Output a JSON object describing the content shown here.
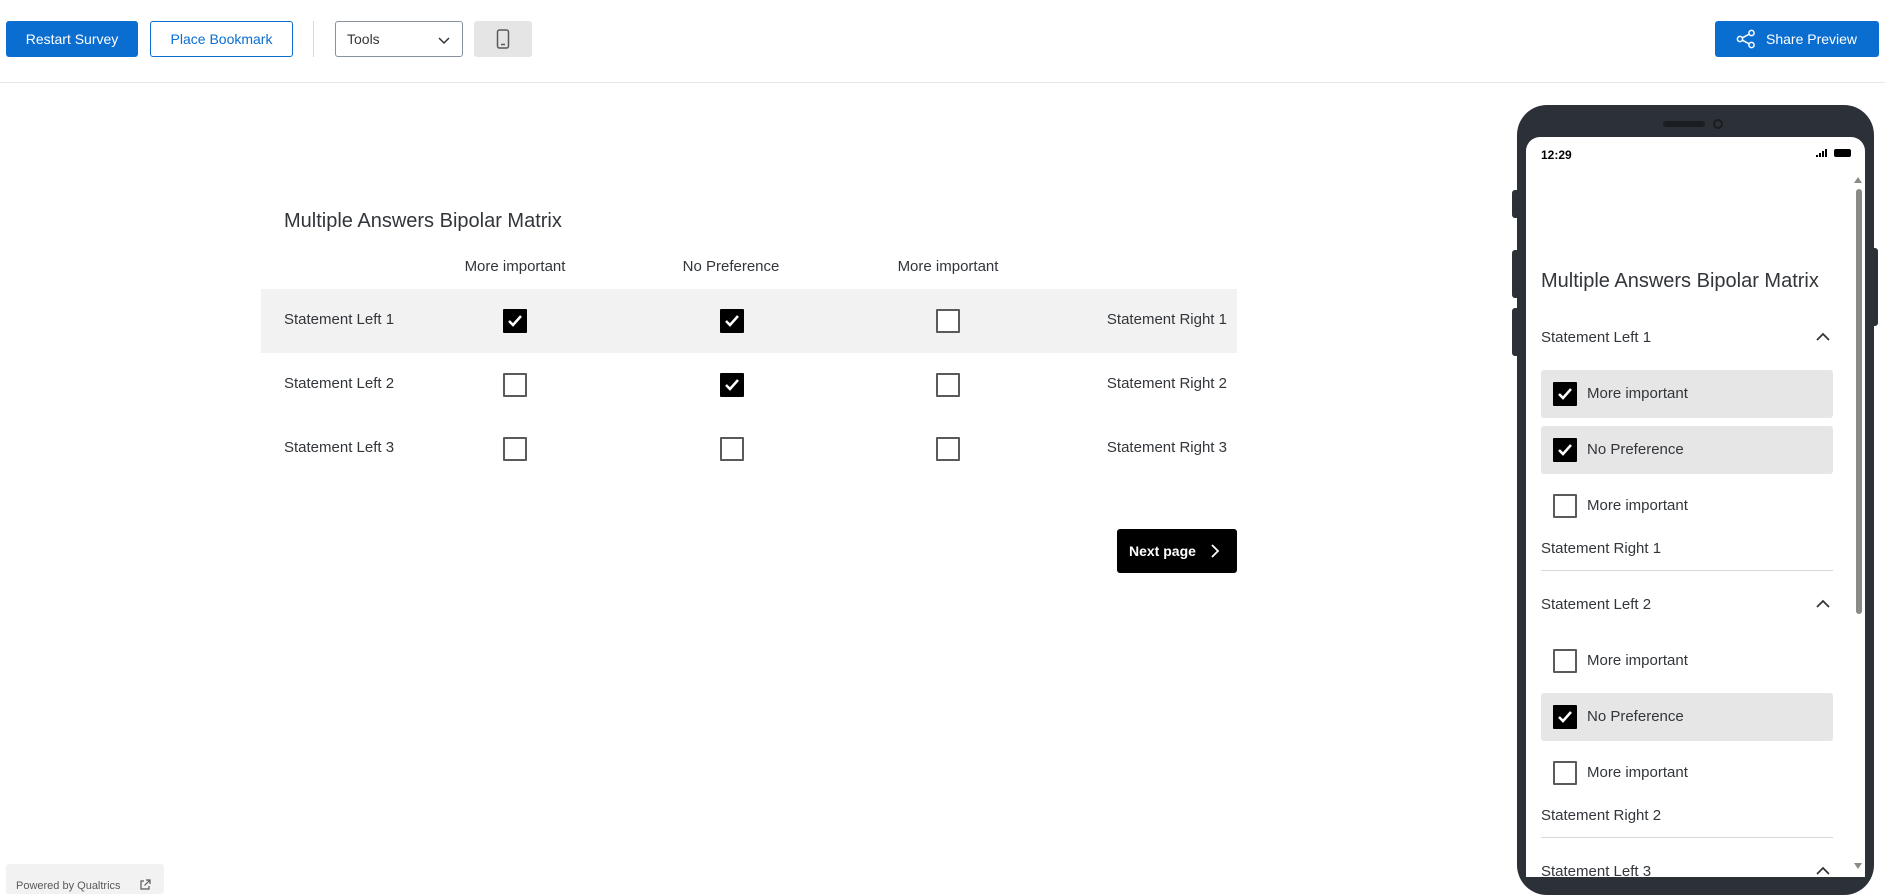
{
  "toolbar": {
    "restart_label": "Restart Survey",
    "bookmark_label": "Place Bookmark",
    "tools_label": "Tools",
    "device_icon": "mobile-device-icon",
    "share_label": "Share Preview",
    "accent_color": "#0a6ed1"
  },
  "survey": {
    "title": "Multiple Answers Bipolar Matrix",
    "columns": [
      "More important",
      "No Preference",
      "More important"
    ],
    "rows": [
      {
        "left": "Statement Left 1",
        "right": "Statement Right 1",
        "checked": [
          true,
          true,
          false
        ]
      },
      {
        "left": "Statement Left 2",
        "right": "Statement Right 2",
        "checked": [
          false,
          true,
          false
        ]
      },
      {
        "left": "Statement Left 3",
        "right": "Statement Right 3",
        "checked": [
          false,
          false,
          false
        ]
      }
    ],
    "next_label": "Next page"
  },
  "footer": {
    "powered_label": "Powered by Qualtrics"
  },
  "phone": {
    "time": "12:29",
    "title": "Multiple Answers Bipolar Matrix",
    "groups": [
      {
        "left": "Statement Left 1",
        "right": "Statement Right 1",
        "options": [
          {
            "label": "More important",
            "checked": true
          },
          {
            "label": "No Preference",
            "checked": true
          },
          {
            "label": "More important",
            "checked": false
          }
        ]
      },
      {
        "left": "Statement Left 2",
        "right": "Statement Right 2",
        "options": [
          {
            "label": "More important",
            "checked": false
          },
          {
            "label": "No Preference",
            "checked": true
          },
          {
            "label": "More important",
            "checked": false
          }
        ]
      }
    ],
    "next_group_left": "Statement Left 3"
  }
}
